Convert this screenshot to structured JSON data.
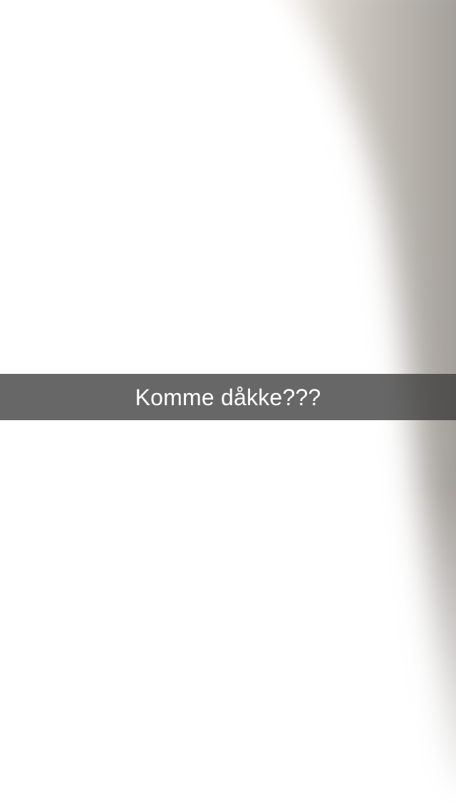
{
  "snap": {
    "caption": "Komme dåkke???",
    "background": "blurred-photo-white-wall-with-grey-shadow"
  },
  "colors": {
    "caption_bar": "#3c3c3c",
    "caption_text": "#ffffff",
    "shadow": "#8f8c89",
    "highlight": "#ffffff"
  }
}
